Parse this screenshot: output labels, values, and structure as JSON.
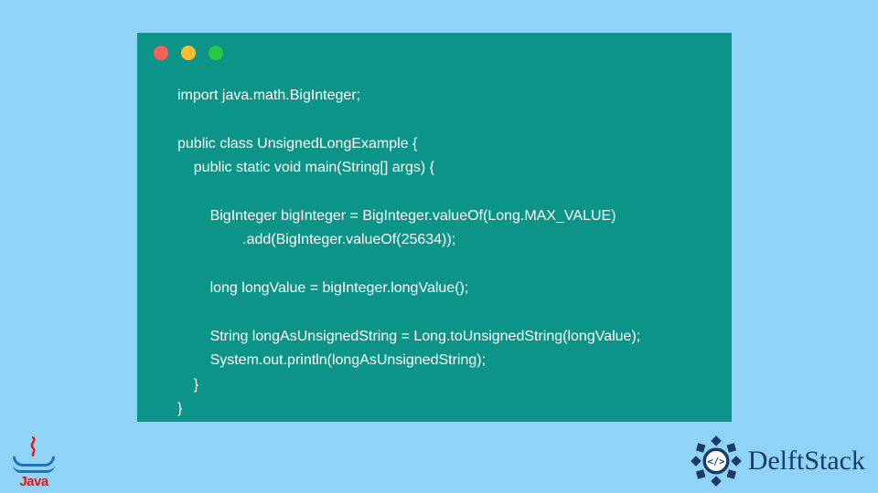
{
  "colors": {
    "page_bg": "#8fd4f7",
    "window_bg": "#0d9488",
    "code_text": "#ffffff",
    "dot_red": "#ff5f57",
    "dot_yellow": "#febc2e",
    "dot_green": "#28c840",
    "java_red": "#ee1111",
    "java_blue": "#1f73b7",
    "delft_blue": "#1b3a66"
  },
  "window": {
    "dots": [
      "red",
      "yellow",
      "green"
    ]
  },
  "code": {
    "language": "java",
    "lines": [
      "import java.math.BigInteger;",
      "",
      "public class UnsignedLongExample {",
      "    public static void main(String[] args) {",
      "",
      "        BigInteger bigInteger = BigInteger.valueOf(Long.MAX_VALUE)",
      "                .add(BigInteger.valueOf(25634));",
      "",
      "        long longValue = bigInteger.longValue();",
      "",
      "        String longAsUnsignedString = Long.toUnsignedString(longValue);",
      "        System.out.println(longAsUnsignedString);",
      "    }",
      "}"
    ],
    "joined": "import java.math.BigInteger;\n\npublic class UnsignedLongExample {\n    public static void main(String[] args) {\n\n        BigInteger bigInteger = BigInteger.valueOf(Long.MAX_VALUE)\n                .add(BigInteger.valueOf(25634));\n\n        long longValue = bigInteger.longValue();\n\n        String longAsUnsignedString = Long.toUnsignedString(longValue);\n        System.out.println(longAsUnsignedString);\n    }\n}"
  },
  "logos": {
    "java": {
      "text": "Java"
    },
    "delftstack": {
      "text": "DelftStack"
    }
  }
}
